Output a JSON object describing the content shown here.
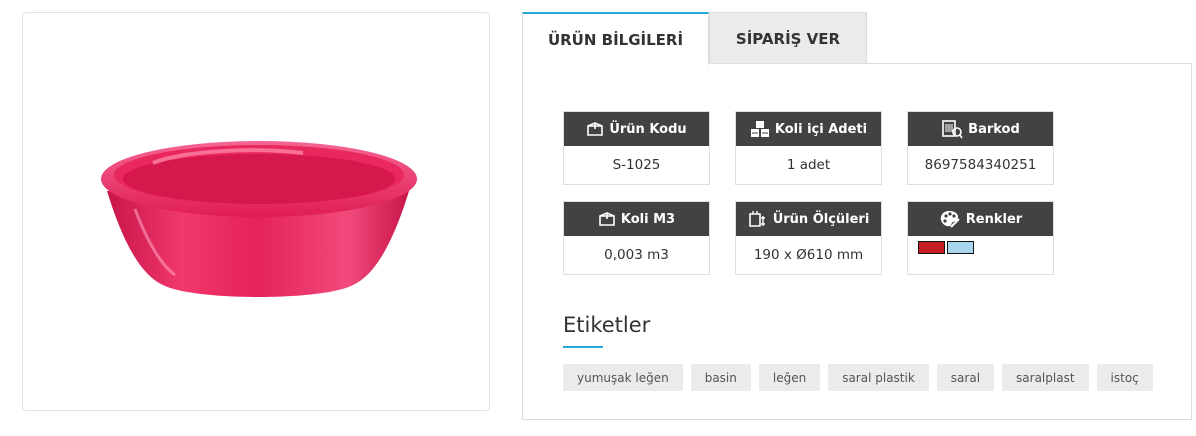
{
  "tabs": [
    {
      "label": "ÜRÜN BİLGİLERİ",
      "active": true
    },
    {
      "label": "SİPARİŞ VER",
      "active": false
    }
  ],
  "info_boxes": {
    "product_code": {
      "label": "Ürün Kodu",
      "value": "S-1025",
      "icon": "box-icon"
    },
    "pack_qty": {
      "label": "Koli içi Adeti",
      "value": "1 adet",
      "icon": "boxes-icon"
    },
    "barcode": {
      "label": "Barkod",
      "value": "8697584340251",
      "icon": "barcode-icon"
    },
    "package_volume": {
      "label": "Koli M3",
      "value": "0,003 m3",
      "icon": "box-icon"
    },
    "dimensions": {
      "label": "Ürün Ölçüleri",
      "value": "190 x Ø610 mm",
      "icon": "measure-icon"
    },
    "colors": {
      "label": "Renkler",
      "icon": "palette-icon",
      "swatches": [
        "#c41e24",
        "#a9d6ee"
      ]
    }
  },
  "tags": {
    "title": "Etiketler",
    "items": [
      "yumuşak leğen",
      "basin",
      "leğen",
      "saral plastik",
      "saral",
      "saralplast",
      "istoç"
    ]
  },
  "colors": {
    "accent": "#2aa8d8",
    "header_dark": "#424242",
    "product": "#e8235a"
  }
}
